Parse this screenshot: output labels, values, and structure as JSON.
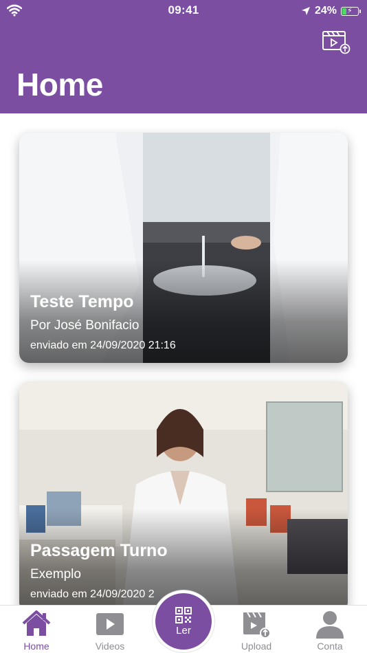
{
  "status_bar": {
    "time": "09:41",
    "battery": "24%"
  },
  "header": {
    "title": "Home",
    "upload_icon": "video-upload-icon"
  },
  "feed": {
    "videos": [
      {
        "title": "Teste Tempo",
        "author": "Por José Bonifacio",
        "date": "enviado em 24/09/2020 21:16"
      },
      {
        "title": "Passagem Turno",
        "author": "Exemplo",
        "date": "enviado em 24/09/2020 2"
      }
    ]
  },
  "tabbar": {
    "accent": "#7c4ea2",
    "inactive": "#8e8e93",
    "tabs": [
      {
        "label": "Home",
        "icon": "home-icon",
        "active": true
      },
      {
        "label": "Videos",
        "icon": "play-icon",
        "active": false
      },
      {
        "label": "Ler",
        "icon": "qr-code-icon",
        "active": false
      },
      {
        "label": "Upload",
        "icon": "video-upload-icon",
        "active": false
      },
      {
        "label": "Conta",
        "icon": "user-icon",
        "active": false
      }
    ]
  },
  "colors": {
    "brand": "#7c4ea2",
    "background": "#ffffff"
  }
}
